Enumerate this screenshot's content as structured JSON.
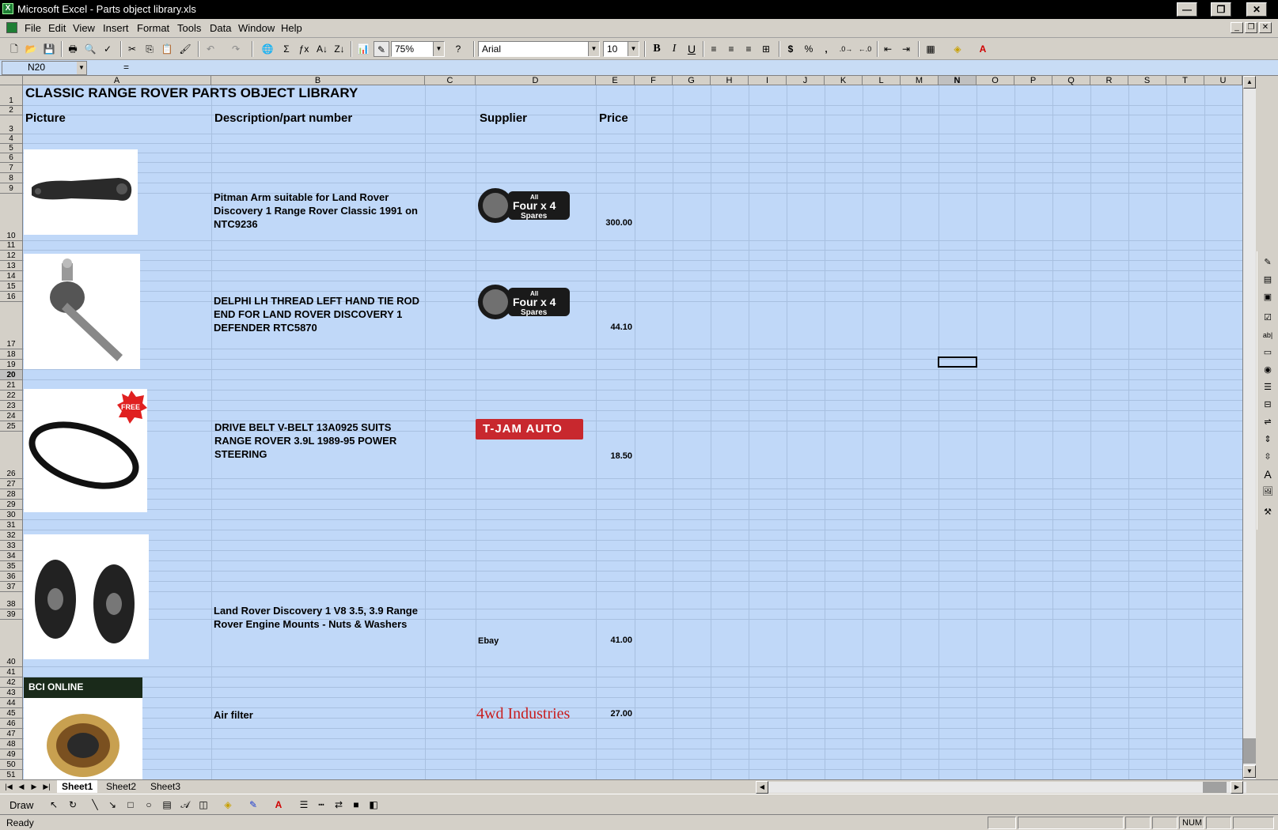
{
  "window": {
    "title": "Microsoft Excel - Parts object library.xls",
    "minimize": "—",
    "restore": "❐",
    "close": "✕"
  },
  "menu": {
    "items": [
      "File",
      "Edit",
      "View",
      "Insert",
      "Format",
      "Tools",
      "Data",
      "Window",
      "Help"
    ]
  },
  "toolbar": {
    "zoom": "75%",
    "font": "Arial",
    "font_size": "10",
    "bold": "B",
    "italic": "I",
    "underline": "U",
    "currency": "$",
    "percent": "%",
    "comma": ","
  },
  "formula_bar": {
    "name_box": "N20",
    "equals": "="
  },
  "columns": [
    "A",
    "B",
    "C",
    "D",
    "E",
    "F",
    "G",
    "H",
    "I",
    "J",
    "K",
    "L",
    "M",
    "N",
    "O",
    "P",
    "Q",
    "R",
    "S",
    "T",
    "U"
  ],
  "sheet": {
    "title": "CLASSIC RANGE ROVER PARTS OBJECT LIBRARY",
    "headers": {
      "picture": "Picture",
      "description": "Description/part number",
      "supplier": "Supplier",
      "price": "Price"
    },
    "parts": [
      {
        "description": "Pitman Arm suitable for Land Rover Discovery 1 Range Rover Classic 1991 on NTC9236",
        "supplier_logo": "all-four-x4-spares-logo",
        "supplier_logo_text": [
          "All",
          "Four x 4",
          "Spares"
        ],
        "price": "300.00"
      },
      {
        "description": "DELPHI LH THREAD LEFT HAND TIE ROD END FOR LAND ROVER DISCOVERY 1 DEFENDER RTC5870",
        "supplier_logo": "all-four-x4-spares-logo",
        "supplier_logo_text": [
          "All",
          "Four x 4",
          "Spares"
        ],
        "price": "44.10"
      },
      {
        "description": "DRIVE BELT V-BELT 13A0925 SUITS RANGE ROVER 3.9L 1989-95 POWER STEERING",
        "supplier_logo": "t-jam-auto-logo",
        "supplier_logo_text": [
          "T-JAM AUTO"
        ],
        "picture_badge": "FREE",
        "price": "18.50"
      },
      {
        "description": "Land Rover Discovery 1 V8 3.5, 3.9 Range Rover Engine Mounts - Nuts & Washers",
        "supplier": "Ebay",
        "price": "41.00"
      },
      {
        "description": "Air filter",
        "supplier_logo": "4wd-industries-logo",
        "supplier_logo_text": [
          "4wd Industries"
        ],
        "picture_banner": "BCI ONLINE",
        "price": "27.00"
      }
    ]
  },
  "sheet_tabs": [
    "Sheet1",
    "Sheet2",
    "Sheet3"
  ],
  "draw_bar": {
    "draw_label": "Draw"
  },
  "status": {
    "ready": "Ready",
    "num": "NUM"
  },
  "colors": {
    "cell_fill": "#c0d8f8",
    "title_bar": "#000000",
    "chrome": "#d4d0c8"
  }
}
